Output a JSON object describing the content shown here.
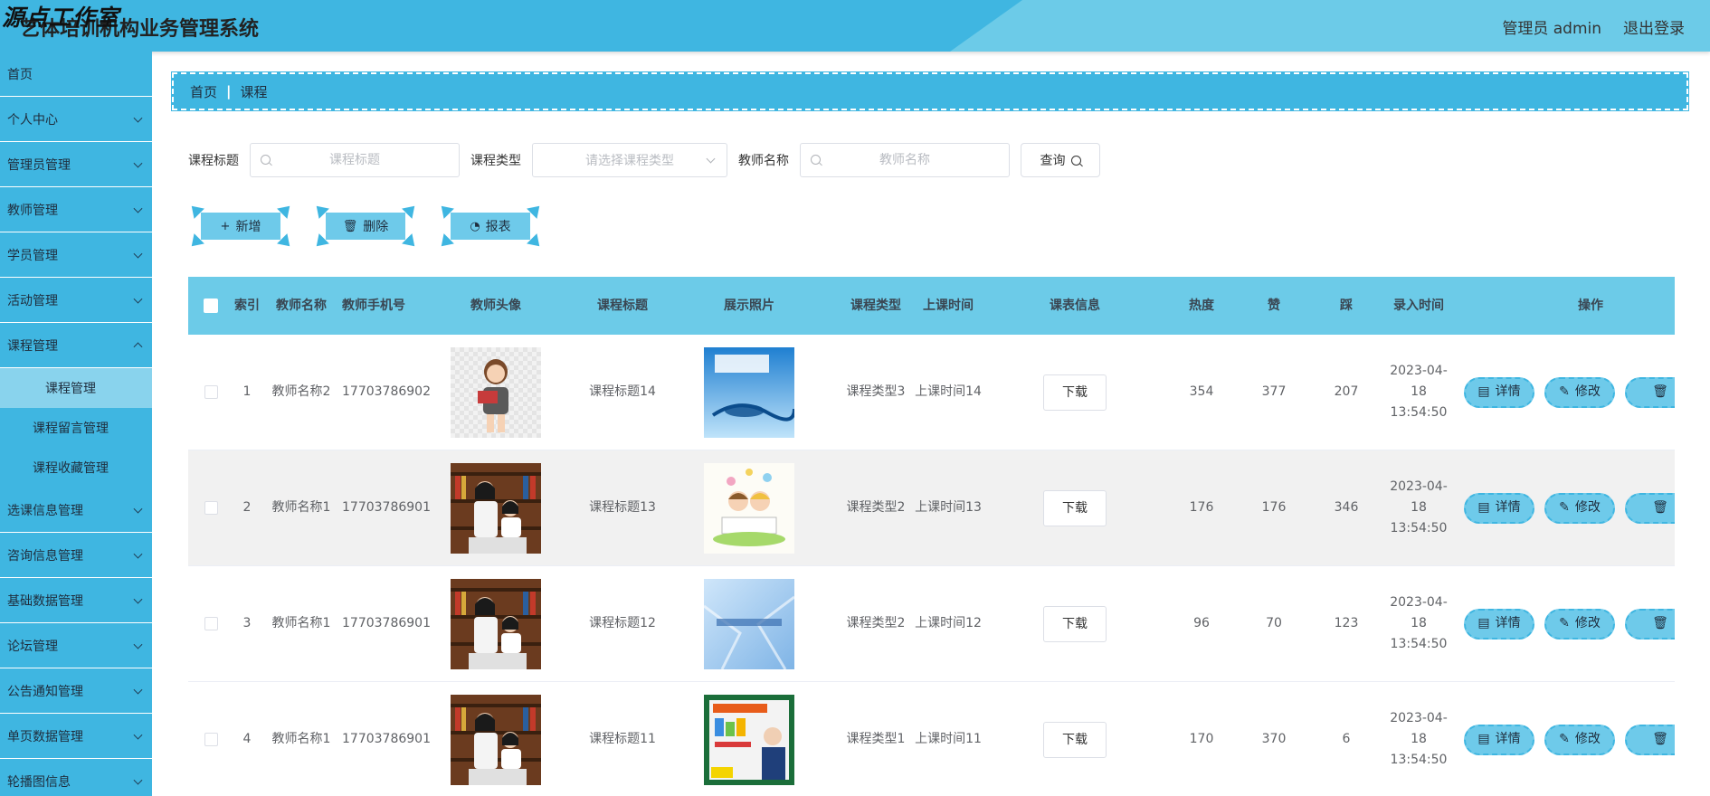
{
  "header": {
    "watermark": "源点工作室",
    "title": "艺体培训机构业务管理系统",
    "user": "管理员 admin",
    "logout": "退出登录"
  },
  "sidebar": {
    "items": [
      {
        "label": "首页",
        "has_arrow": false
      },
      {
        "label": "个人中心",
        "has_arrow": true
      },
      {
        "label": "管理员管理",
        "has_arrow": true
      },
      {
        "label": "教师管理",
        "has_arrow": true
      },
      {
        "label": "学员管理",
        "has_arrow": true
      },
      {
        "label": "活动管理",
        "has_arrow": true
      },
      {
        "label": "课程管理",
        "has_arrow": true,
        "open": true,
        "children": [
          {
            "label": "课程管理",
            "active": true
          },
          {
            "label": "课程留言管理"
          },
          {
            "label": "课程收藏管理"
          }
        ]
      },
      {
        "label": "选课信息管理",
        "has_arrow": true
      },
      {
        "label": "咨询信息管理",
        "has_arrow": true
      },
      {
        "label": "基础数据管理",
        "has_arrow": true
      },
      {
        "label": "论坛管理",
        "has_arrow": true
      },
      {
        "label": "公告通知管理",
        "has_arrow": true
      },
      {
        "label": "单页数据管理",
        "has_arrow": true
      },
      {
        "label": "轮播图信息",
        "has_arrow": true
      }
    ]
  },
  "breadcrumb": {
    "home": "首页",
    "sep": "|",
    "current": "课程"
  },
  "search": {
    "title_label": "课程标题",
    "title_placeholder": "课程标题",
    "type_label": "课程类型",
    "type_placeholder": "请选择课程类型",
    "teacher_label": "教师名称",
    "teacher_placeholder": "教师名称",
    "query_label": "查询"
  },
  "actions": {
    "add": "新增",
    "delete": "删除",
    "report": "报表"
  },
  "table": {
    "headers": {
      "index": "索引",
      "teacher_name": "教师名称",
      "teacher_phone": "教师手机号",
      "teacher_avatar": "教师头像",
      "course_title": "课程标题",
      "photo": "展示照片",
      "course_type": "课程类型",
      "class_time": "上课时间",
      "schedule": "课表信息",
      "heat": "热度",
      "like": "赞",
      "dislike": "踩",
      "record_time": "录入时间",
      "operations": "操作"
    },
    "download_label": "下载",
    "detail_label": "详情",
    "edit_label": "修改",
    "rows": [
      {
        "index": "1",
        "teacher_name": "教师名称2",
        "teacher_phone": "17703786902",
        "avatar": "cartoon-teacher",
        "course_title": "课程标题14",
        "photo": "physics-book-cover",
        "course_type": "课程类型3",
        "class_time": "上课时间14",
        "heat": "354",
        "like": "377",
        "dislike": "207",
        "record_time": "2023-04-18 13:54:50"
      },
      {
        "index": "2",
        "teacher_name": "教师名称1",
        "teacher_phone": "17703786901",
        "avatar": "teacher-and-student",
        "course_title": "课程标题13",
        "photo": "children-reading-illustration",
        "course_type": "课程类型2",
        "class_time": "上课时间13",
        "heat": "176",
        "like": "176",
        "dislike": "346",
        "record_time": "2023-04-18 13:54:50"
      },
      {
        "index": "3",
        "teacher_name": "教师名称1",
        "teacher_phone": "17703786901",
        "avatar": "teacher-and-student",
        "course_title": "课程标题12",
        "photo": "computer-network-basics-cover",
        "course_type": "课程类型2",
        "class_time": "上课时间12",
        "heat": "96",
        "like": "70",
        "dislike": "123",
        "record_time": "2023-04-18 13:54:50"
      },
      {
        "index": "4",
        "teacher_name": "教师名称1",
        "teacher_phone": "17703786901",
        "avatar": "teacher-and-student",
        "course_title": "课程标题11",
        "photo": "teacher-lecture-poster",
        "course_type": "课程类型1",
        "class_time": "上课时间11",
        "heat": "170",
        "like": "370",
        "dislike": "6",
        "record_time": "2023-04-18 13:54:50"
      }
    ]
  },
  "colors": {
    "primary": "#3fb6e1",
    "header_band": "#6ccbe8",
    "button": "#6ecaea"
  }
}
